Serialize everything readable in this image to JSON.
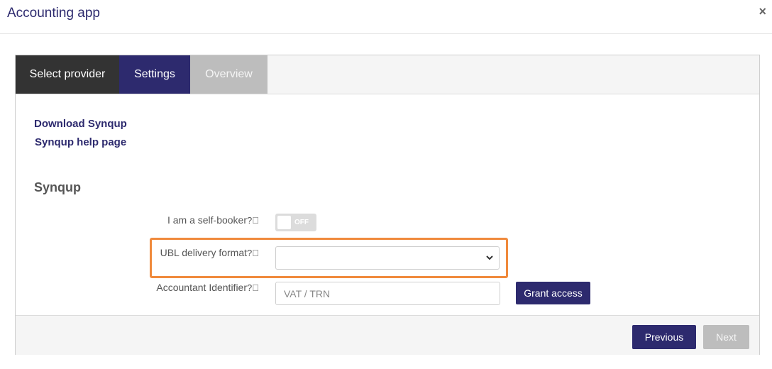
{
  "modal": {
    "title": "Accounting app",
    "close_symbol": "×"
  },
  "tabs": [
    {
      "label": "Select provider",
      "state": "done"
    },
    {
      "label": "Settings",
      "state": "active"
    },
    {
      "label": "Overview",
      "state": "disabled"
    }
  ],
  "links": {
    "download": "Download Synqup",
    "help": "Synqup help page"
  },
  "section": {
    "title": "Synqup"
  },
  "form": {
    "self_booker": {
      "label": "I am a self-booker",
      "help_icon": "question-circle-icon",
      "toggle_text": "OFF",
      "value": false
    },
    "ubl_format": {
      "label": "UBL delivery format",
      "help_icon": "question-circle-icon",
      "value": ""
    },
    "accountant": {
      "label": "Accountant Identifier",
      "help_icon": "question-circle-icon",
      "placeholder": "VAT / TRN",
      "value": ""
    },
    "grant_label": "Grant access"
  },
  "footer": {
    "previous_label": "Previous",
    "next_label": "Next"
  },
  "colors": {
    "primary": "#2d2a6e",
    "dark_tab": "#333333",
    "disabled": "#bdbdbd",
    "highlight": "#f08a3c"
  }
}
